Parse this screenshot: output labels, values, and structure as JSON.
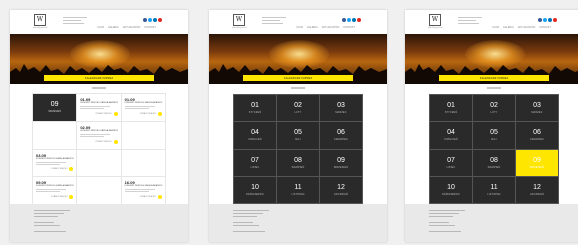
{
  "brand": {
    "logo_mark": "W",
    "logo_sub": "klub Wyspiański"
  },
  "nav": [
    "KLUB",
    "GALERIA",
    "AKTUALNOŚCI",
    "KONTAKT"
  ],
  "social_colors": [
    "#3b5998",
    "#1da1f2",
    "#0077b5",
    "#e02a20"
  ],
  "accent": "#ffe600",
  "dark_cell": "#2a2a2a",
  "section_title": "KALENDARZ IMPREZ",
  "mockup1": {
    "month_cell": {
      "num": "09",
      "label": "WRZESIEŃ"
    },
    "events": [
      {
        "date": "01.09",
        "title": "KONCERT ZESPOŁU KAPELA BEATBOX",
        "more": "ZOBACZ WIĘCEJ"
      },
      {
        "date": "01.09",
        "title": "KONCERT ZESPOŁU KAPELA BEATBOX",
        "more": "ZOBACZ WIĘCEJ"
      },
      {
        "date": "02.09",
        "title": "KONCERT ZESPOŁU KAPELA BEATBOX",
        "more": "ZOBACZ WIĘCEJ"
      },
      {
        "date": "03.09",
        "title": "KONCERT ZESPOŁU KAPELA BEATBOX",
        "more": "ZOBACZ WIĘCEJ"
      },
      {
        "date": "09.09",
        "title": "KONCERT ZESPOŁU KAPELA BEATBOX",
        "more": "ZOBACZ WIĘCEJ"
      },
      {
        "date": "16.09",
        "title": "KONCERT ZESPOŁU KAPELA BEATBOX",
        "more": "ZOBACZ WIĘCEJ"
      }
    ]
  },
  "months": [
    {
      "num": "01",
      "label": "STYCZEŃ"
    },
    {
      "num": "02",
      "label": "LUTY"
    },
    {
      "num": "03",
      "label": "MARZEC"
    },
    {
      "num": "04",
      "label": "KWIECIEŃ"
    },
    {
      "num": "05",
      "label": "MAJ"
    },
    {
      "num": "06",
      "label": "CZERWIEC"
    },
    {
      "num": "07",
      "label": "LIPIEC"
    },
    {
      "num": "08",
      "label": "SIERPIEŃ"
    },
    {
      "num": "09",
      "label": "WRZESIEŃ"
    },
    {
      "num": "10",
      "label": "PAŹDZIERNIK"
    },
    {
      "num": "11",
      "label": "LISTOPAD"
    },
    {
      "num": "12",
      "label": "GRUDZIEŃ"
    }
  ],
  "mockup3": {
    "active_month_index": 8
  }
}
